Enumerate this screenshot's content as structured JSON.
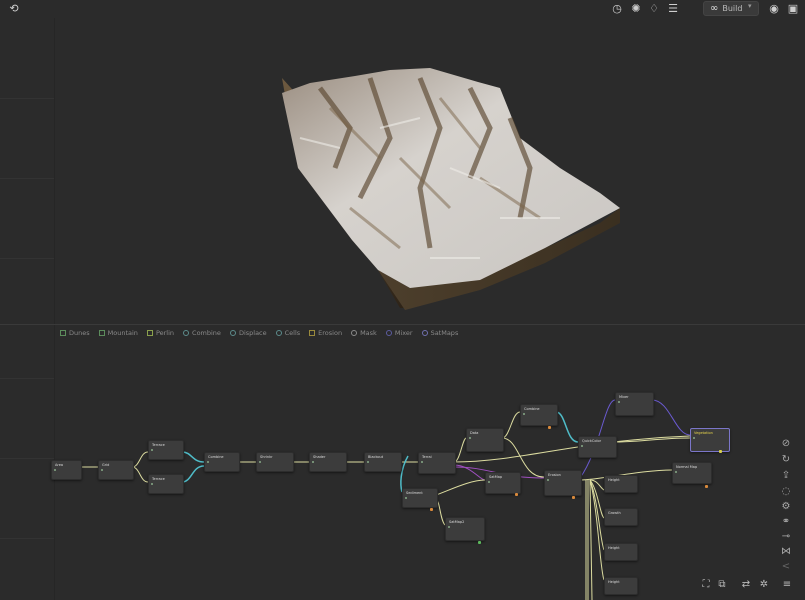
{
  "topbar": {
    "build_label": "Build",
    "icons": [
      "undo-icon",
      "timer-icon",
      "sun-icon",
      "water-drop-icon",
      "layers-icon",
      "infinity-icon",
      "chevron-down-icon",
      "record-icon",
      "window-icon"
    ]
  },
  "toolbox": {
    "items": [
      {
        "label": "Dunes",
        "color": "#5c8c5c",
        "shape": "square"
      },
      {
        "label": "Mountain",
        "color": "#5c8c5c",
        "shape": "square"
      },
      {
        "label": "Perlin",
        "color": "#8aa04c",
        "shape": "square"
      },
      {
        "label": "Combine",
        "color": "#5c8c8c",
        "shape": "link"
      },
      {
        "label": "Displace",
        "color": "#5c8c8c",
        "shape": "link"
      },
      {
        "label": "Cells",
        "color": "#5c8c8c",
        "shape": "round"
      },
      {
        "label": "Erosion",
        "color": "#9a8a3c",
        "shape": "square"
      },
      {
        "label": "Mask",
        "color": "#8a8a8a",
        "shape": "round"
      },
      {
        "label": "Mixer",
        "color": "#5c5ca0",
        "shape": "round"
      },
      {
        "label": "SatMaps",
        "color": "#7070b0",
        "shape": "round"
      }
    ]
  },
  "graph": {
    "nodes": [
      {
        "label": "Area"
      },
      {
        "label": "Grid"
      },
      {
        "label": "Terrace"
      },
      {
        "label": "Terrace"
      },
      {
        "label": "Combine"
      },
      {
        "label": "Shrinkr"
      },
      {
        "label": "Shader"
      },
      {
        "label": "Blackout"
      },
      {
        "label": "Terrai"
      },
      {
        "label": "Sediment"
      },
      {
        "label": "Data"
      },
      {
        "label": "Combine"
      },
      {
        "label": "SatMap"
      },
      {
        "label": "SatMap2"
      },
      {
        "label": "Mixer"
      },
      {
        "label": "QuickColor"
      },
      {
        "label": "Erosion"
      },
      {
        "label": "Vegetation"
      },
      {
        "label": "Normal Map"
      },
      {
        "label": "Height"
      },
      {
        "label": "Growth"
      },
      {
        "label": "Height"
      },
      {
        "label": "Height"
      }
    ]
  },
  "right_tools": [
    "disable-icon",
    "refresh-icon",
    "export-icon",
    "circle-icon",
    "gear-icon",
    "link-icon",
    "connect-icon",
    "graph-icon",
    "share-icon"
  ],
  "bottom_tools": [
    "fit-view-icon",
    "copy-icon",
    "sync-icon",
    "auto-layout-icon",
    "menu-icon"
  ]
}
